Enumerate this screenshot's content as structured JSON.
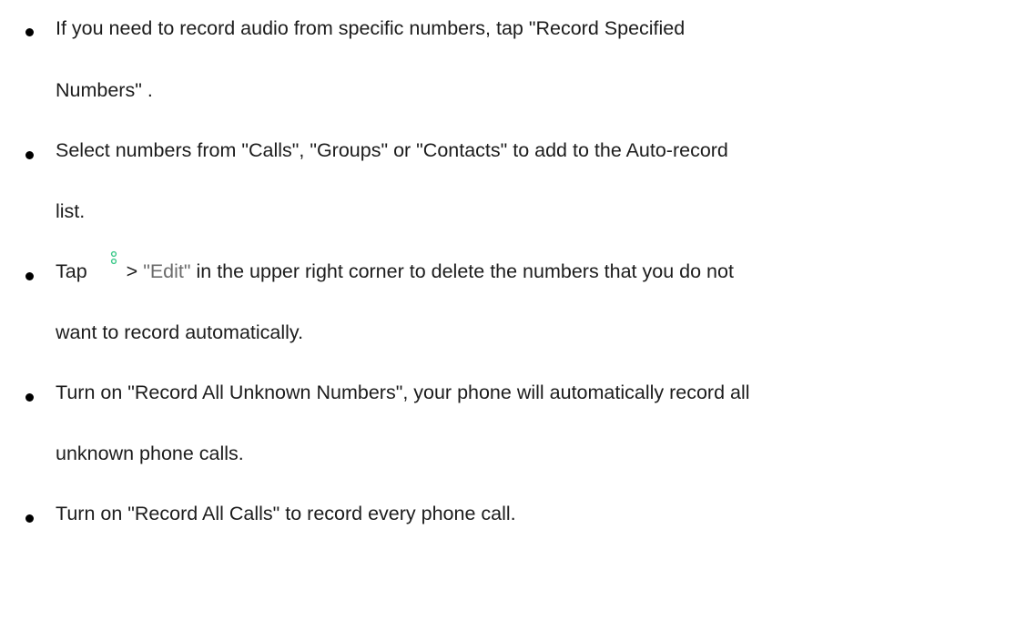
{
  "items": [
    {
      "lines": [
        "If you need to record audio from specific numbers, tap \"Record Specified",
        "Numbers\" ."
      ]
    },
    {
      "lines": [
        "Select numbers from \"Calls\", \"Groups\" or \"Contacts\" to add to the Auto-record",
        "list."
      ]
    },
    {
      "first_line": {
        "before_icon": "Tap",
        "icon": "more-options-icon",
        "between": "> ",
        "edit": "\"Edit\"",
        "after": " in the upper right corner to delete the numbers that you do not"
      },
      "lines": [
        "",
        "want to record automatically."
      ]
    },
    {
      "lines": [
        "Turn on \"Record All Unknown Numbers\", your phone will automatically record all",
        "unknown phone calls."
      ]
    },
    {
      "lines": [
        "Turn on \"Record All Calls\" to record every phone call."
      ]
    }
  ],
  "colors": {
    "icon_accent": "#3cc98a",
    "text": "#1c1c1c",
    "edit_text": "#6b6b6b"
  }
}
